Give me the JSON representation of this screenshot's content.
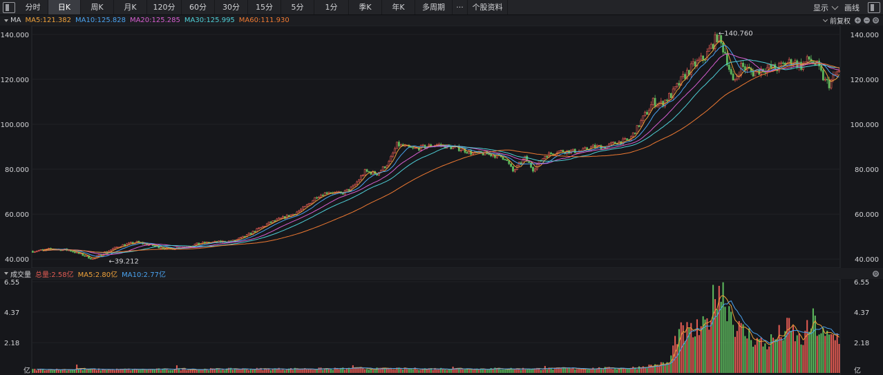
{
  "toolbar": {
    "tabs": [
      {
        "label": "分时",
        "active": false
      },
      {
        "label": "日K",
        "active": true
      },
      {
        "label": "周K",
        "active": false
      },
      {
        "label": "月K",
        "active": false
      },
      {
        "label": "120分",
        "active": false
      },
      {
        "label": "60分",
        "active": false
      },
      {
        "label": "30分",
        "active": false
      },
      {
        "label": "15分",
        "active": false
      },
      {
        "label": "5分",
        "active": false
      },
      {
        "label": "1分",
        "active": false
      },
      {
        "label": "季K",
        "active": false
      },
      {
        "label": "年K",
        "active": false
      },
      {
        "label": "多周期",
        "active": false
      },
      {
        "label": "···",
        "active": false
      },
      {
        "label": "个股资料",
        "active": false
      }
    ],
    "display_label": "显示",
    "draw_label": "画线"
  },
  "price_legend": {
    "name": "MA",
    "ma5": "MA5:121.382",
    "ma10": "MA10:125.828",
    "ma20": "MA20:125.285",
    "ma30": "MA30:125.995",
    "ma60": "MA60:111.930",
    "adjust": "前复权"
  },
  "volume_legend": {
    "name": "成交量",
    "total": "总量:2.58亿",
    "ma5": "MA5:2.80亿",
    "ma10": "MA10:2.77亿"
  },
  "colors": {
    "up": "#e05a52",
    "down": "#5cb85c",
    "ma5": "#f0a23a",
    "ma10": "#4aa3f0",
    "ma20": "#d75ed1",
    "ma30": "#4fd0d8",
    "ma60": "#f07a32"
  },
  "chart_data": {
    "type": "candlestick",
    "price_axis": {
      "ticks": [
        "140.000",
        "120.000",
        "100.000",
        "80.000",
        "60.000",
        "40.000"
      ],
      "values": [
        140,
        120,
        100,
        80,
        60,
        40
      ],
      "ylim": [
        38.5,
        141.5
      ]
    },
    "annotations": {
      "high": "←140.760",
      "high_value": 140.76,
      "low": "←39.212",
      "low_value": 39.212
    },
    "volume_axis": {
      "ticks": [
        "6.55",
        "4.37",
        "2.18"
      ],
      "values": [
        6.55,
        4.37,
        2.18
      ],
      "unit": "亿",
      "ylim": [
        0,
        6.55
      ]
    },
    "price_anchors": [
      [
        0,
        43.5
      ],
      [
        10,
        44.5
      ],
      [
        18,
        44
      ],
      [
        26,
        41.5
      ],
      [
        30,
        40
      ],
      [
        36,
        43
      ],
      [
        44,
        46
      ],
      [
        52,
        47.5
      ],
      [
        60,
        46
      ],
      [
        68,
        44.5
      ],
      [
        76,
        45.5
      ],
      [
        84,
        47
      ],
      [
        92,
        47.5
      ],
      [
        100,
        48
      ],
      [
        106,
        50
      ],
      [
        112,
        53
      ],
      [
        118,
        56
      ],
      [
        124,
        58
      ],
      [
        130,
        60
      ],
      [
        136,
        63
      ],
      [
        142,
        68
      ],
      [
        148,
        70
      ],
      [
        154,
        69
      ],
      [
        160,
        72
      ],
      [
        166,
        79
      ],
      [
        172,
        78
      ],
      [
        178,
        83
      ],
      [
        182,
        91
      ],
      [
        186,
        90
      ],
      [
        190,
        89
      ],
      [
        196,
        90
      ],
      [
        202,
        91
      ],
      [
        208,
        90
      ],
      [
        214,
        89
      ],
      [
        220,
        87
      ],
      [
        226,
        87
      ],
      [
        232,
        86
      ],
      [
        236,
        85
      ],
      [
        240,
        79
      ],
      [
        246,
        85
      ],
      [
        250,
        80
      ],
      [
        256,
        86
      ],
      [
        262,
        88
      ],
      [
        268,
        88
      ],
      [
        274,
        88
      ],
      [
        280,
        90
      ],
      [
        286,
        90
      ],
      [
        292,
        92
      ],
      [
        298,
        93
      ],
      [
        304,
        101
      ],
      [
        310,
        110
      ],
      [
        314,
        109
      ],
      [
        320,
        114
      ],
      [
        326,
        122
      ],
      [
        330,
        126
      ],
      [
        336,
        130
      ],
      [
        342,
        139
      ],
      [
        346,
        132
      ],
      [
        350,
        118
      ],
      [
        354,
        126
      ],
      [
        360,
        123
      ],
      [
        366,
        125
      ],
      [
        372,
        125
      ],
      [
        376,
        127
      ],
      [
        380,
        128
      ],
      [
        384,
        126
      ],
      [
        388,
        129
      ],
      [
        392,
        126
      ],
      [
        396,
        119
      ],
      [
        398,
        118
      ],
      [
        402,
        123
      ]
    ],
    "volume_anchors": [
      [
        0,
        0.25
      ],
      [
        50,
        0.25
      ],
      [
        100,
        0.28
      ],
      [
        150,
        0.3
      ],
      [
        200,
        0.3
      ],
      [
        250,
        0.3
      ],
      [
        300,
        0.35
      ],
      [
        318,
        0.7
      ],
      [
        322,
        2.8
      ],
      [
        330,
        2.9
      ],
      [
        336,
        3.2
      ],
      [
        340,
        5.0
      ],
      [
        342,
        6.55
      ],
      [
        346,
        5.5
      ],
      [
        352,
        3.2
      ],
      [
        360,
        2.5
      ],
      [
        366,
        2.0
      ],
      [
        372,
        2.6
      ],
      [
        378,
        3.2
      ],
      [
        384,
        2.2
      ],
      [
        390,
        3.7
      ],
      [
        396,
        2.5
      ],
      [
        402,
        2.6
      ]
    ],
    "volume_spikes": [
      [
        22,
        0.6
      ],
      [
        72,
        0.55
      ],
      [
        160,
        0.55
      ],
      [
        210,
        0.45
      ],
      [
        256,
        0.5
      ],
      [
        300,
        0.45
      ]
    ],
    "candle_count": 404,
    "series": [
      {
        "name": "MA5",
        "period": 5
      },
      {
        "name": "MA10",
        "period": 10
      },
      {
        "name": "MA20",
        "period": 20
      },
      {
        "name": "MA30",
        "period": 30
      },
      {
        "name": "MA60",
        "period": 60
      }
    ],
    "volume_series": [
      {
        "name": "MA5",
        "period": 5
      },
      {
        "name": "MA10",
        "period": 10
      }
    ]
  }
}
